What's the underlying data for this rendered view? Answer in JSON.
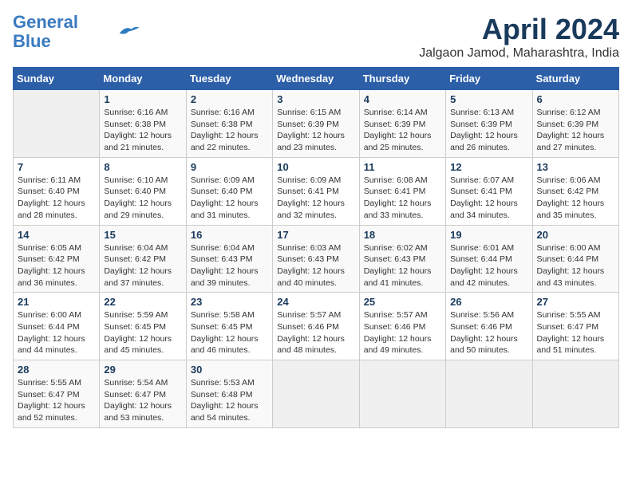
{
  "header": {
    "logo_line1": "General",
    "logo_line2": "Blue",
    "title": "April 2024",
    "location": "Jalgaon Jamod, Maharashtra, India"
  },
  "days_of_week": [
    "Sunday",
    "Monday",
    "Tuesday",
    "Wednesday",
    "Thursday",
    "Friday",
    "Saturday"
  ],
  "weeks": [
    [
      {
        "day": "",
        "info": ""
      },
      {
        "day": "1",
        "info": "Sunrise: 6:16 AM\nSunset: 6:38 PM\nDaylight: 12 hours\nand 21 minutes."
      },
      {
        "day": "2",
        "info": "Sunrise: 6:16 AM\nSunset: 6:38 PM\nDaylight: 12 hours\nand 22 minutes."
      },
      {
        "day": "3",
        "info": "Sunrise: 6:15 AM\nSunset: 6:39 PM\nDaylight: 12 hours\nand 23 minutes."
      },
      {
        "day": "4",
        "info": "Sunrise: 6:14 AM\nSunset: 6:39 PM\nDaylight: 12 hours\nand 25 minutes."
      },
      {
        "day": "5",
        "info": "Sunrise: 6:13 AM\nSunset: 6:39 PM\nDaylight: 12 hours\nand 26 minutes."
      },
      {
        "day": "6",
        "info": "Sunrise: 6:12 AM\nSunset: 6:39 PM\nDaylight: 12 hours\nand 27 minutes."
      }
    ],
    [
      {
        "day": "7",
        "info": "Sunrise: 6:11 AM\nSunset: 6:40 PM\nDaylight: 12 hours\nand 28 minutes."
      },
      {
        "day": "8",
        "info": "Sunrise: 6:10 AM\nSunset: 6:40 PM\nDaylight: 12 hours\nand 29 minutes."
      },
      {
        "day": "9",
        "info": "Sunrise: 6:09 AM\nSunset: 6:40 PM\nDaylight: 12 hours\nand 31 minutes."
      },
      {
        "day": "10",
        "info": "Sunrise: 6:09 AM\nSunset: 6:41 PM\nDaylight: 12 hours\nand 32 minutes."
      },
      {
        "day": "11",
        "info": "Sunrise: 6:08 AM\nSunset: 6:41 PM\nDaylight: 12 hours\nand 33 minutes."
      },
      {
        "day": "12",
        "info": "Sunrise: 6:07 AM\nSunset: 6:41 PM\nDaylight: 12 hours\nand 34 minutes."
      },
      {
        "day": "13",
        "info": "Sunrise: 6:06 AM\nSunset: 6:42 PM\nDaylight: 12 hours\nand 35 minutes."
      }
    ],
    [
      {
        "day": "14",
        "info": "Sunrise: 6:05 AM\nSunset: 6:42 PM\nDaylight: 12 hours\nand 36 minutes."
      },
      {
        "day": "15",
        "info": "Sunrise: 6:04 AM\nSunset: 6:42 PM\nDaylight: 12 hours\nand 37 minutes."
      },
      {
        "day": "16",
        "info": "Sunrise: 6:04 AM\nSunset: 6:43 PM\nDaylight: 12 hours\nand 39 minutes."
      },
      {
        "day": "17",
        "info": "Sunrise: 6:03 AM\nSunset: 6:43 PM\nDaylight: 12 hours\nand 40 minutes."
      },
      {
        "day": "18",
        "info": "Sunrise: 6:02 AM\nSunset: 6:43 PM\nDaylight: 12 hours\nand 41 minutes."
      },
      {
        "day": "19",
        "info": "Sunrise: 6:01 AM\nSunset: 6:44 PM\nDaylight: 12 hours\nand 42 minutes."
      },
      {
        "day": "20",
        "info": "Sunrise: 6:00 AM\nSunset: 6:44 PM\nDaylight: 12 hours\nand 43 minutes."
      }
    ],
    [
      {
        "day": "21",
        "info": "Sunrise: 6:00 AM\nSunset: 6:44 PM\nDaylight: 12 hours\nand 44 minutes."
      },
      {
        "day": "22",
        "info": "Sunrise: 5:59 AM\nSunset: 6:45 PM\nDaylight: 12 hours\nand 45 minutes."
      },
      {
        "day": "23",
        "info": "Sunrise: 5:58 AM\nSunset: 6:45 PM\nDaylight: 12 hours\nand 46 minutes."
      },
      {
        "day": "24",
        "info": "Sunrise: 5:57 AM\nSunset: 6:46 PM\nDaylight: 12 hours\nand 48 minutes."
      },
      {
        "day": "25",
        "info": "Sunrise: 5:57 AM\nSunset: 6:46 PM\nDaylight: 12 hours\nand 49 minutes."
      },
      {
        "day": "26",
        "info": "Sunrise: 5:56 AM\nSunset: 6:46 PM\nDaylight: 12 hours\nand 50 minutes."
      },
      {
        "day": "27",
        "info": "Sunrise: 5:55 AM\nSunset: 6:47 PM\nDaylight: 12 hours\nand 51 minutes."
      }
    ],
    [
      {
        "day": "28",
        "info": "Sunrise: 5:55 AM\nSunset: 6:47 PM\nDaylight: 12 hours\nand 52 minutes."
      },
      {
        "day": "29",
        "info": "Sunrise: 5:54 AM\nSunset: 6:47 PM\nDaylight: 12 hours\nand 53 minutes."
      },
      {
        "day": "30",
        "info": "Sunrise: 5:53 AM\nSunset: 6:48 PM\nDaylight: 12 hours\nand 54 minutes."
      },
      {
        "day": "",
        "info": ""
      },
      {
        "day": "",
        "info": ""
      },
      {
        "day": "",
        "info": ""
      },
      {
        "day": "",
        "info": ""
      }
    ]
  ]
}
